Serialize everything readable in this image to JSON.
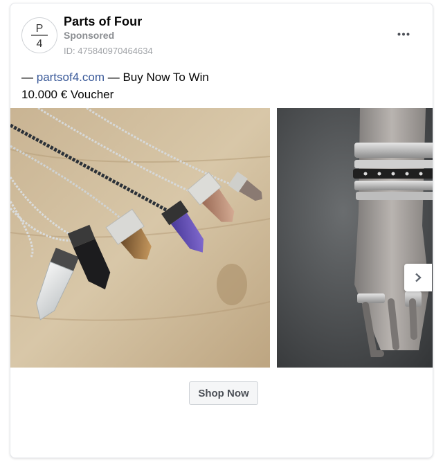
{
  "post": {
    "page_name": "Parts of Four",
    "sponsored_label": "Sponsored",
    "ad_id": "ID: 475840970464634",
    "avatar_top": "P",
    "avatar_bottom": "4",
    "more_icon": "more-dots-icon"
  },
  "ad_text": {
    "line1_prefix": "— ",
    "link": "partsof4.com",
    "line1_suffix": " — Buy Now To Win",
    "line2": "10.000 € Voucher"
  },
  "carousel": {
    "slides": [
      {
        "image": "necklaces-with-crystal-pendants"
      },
      {
        "image": "silver-bracelets-and-rings-on-hand"
      }
    ],
    "next_icon": "chevron-right-icon"
  },
  "cta": {
    "label": "Shop Now"
  },
  "colors": {
    "link": "#385898",
    "muted": "#8a8d91",
    "text": "#050505"
  }
}
